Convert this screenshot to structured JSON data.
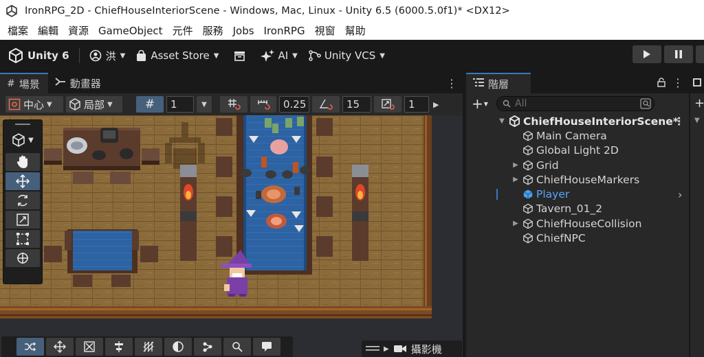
{
  "window": {
    "title": "IronRPG_2D - ChiefHouseInteriorScene - Windows, Mac, Linux - Unity 6.5 (6000.5.0f1)* <DX12>"
  },
  "menubar": {
    "items": [
      "檔案",
      "編輯",
      "資源",
      "GameObject",
      "元件",
      "服務",
      "Jobs",
      "IronRPG",
      "視窗",
      "幫助"
    ]
  },
  "toolbar": {
    "unity_label": "Unity 6",
    "account_label": "洪",
    "asset_store_label": "Asset Store",
    "ai_label": "AI",
    "vcs_label": "Unity VCS"
  },
  "scene_panel": {
    "tabs": [
      {
        "label": "場景",
        "icon": "scene-grid-icon",
        "active": true
      },
      {
        "label": "動畫器",
        "icon": "animator-icon",
        "active": false
      }
    ],
    "toolbar": {
      "pivot_label": "中心",
      "space_label": "局部",
      "grid_size": "1",
      "snap_move": "0.25",
      "snap_rotate": "15",
      "snap_scale": "1"
    },
    "camera_overlay_label": "攝影機"
  },
  "hierarchy": {
    "tab_label": "階層",
    "search_placeholder": "All",
    "scene_name": "ChiefHouseInteriorScene*",
    "items": [
      {
        "label": "Main Camera",
        "expandable": false,
        "selected": false
      },
      {
        "label": "Global Light 2D",
        "expandable": false,
        "selected": false
      },
      {
        "label": "Grid",
        "expandable": true,
        "selected": false
      },
      {
        "label": "ChiefHouseMarkers",
        "expandable": true,
        "selected": false
      },
      {
        "label": "Player",
        "expandable": false,
        "selected": true
      },
      {
        "label": "Tavern_01_2",
        "expandable": false,
        "selected": false
      },
      {
        "label": "ChiefHouseCollision",
        "expandable": true,
        "selected": false
      },
      {
        "label": "ChiefNPC",
        "expandable": false,
        "selected": false
      }
    ]
  },
  "colors": {
    "editor_dark": "#191919",
    "panel": "#282828",
    "accent_blue": "#46607c",
    "selection_text": "#58a6ff",
    "floor_wood": "#8a6a3c",
    "table_blue": "#2c5f9e"
  }
}
